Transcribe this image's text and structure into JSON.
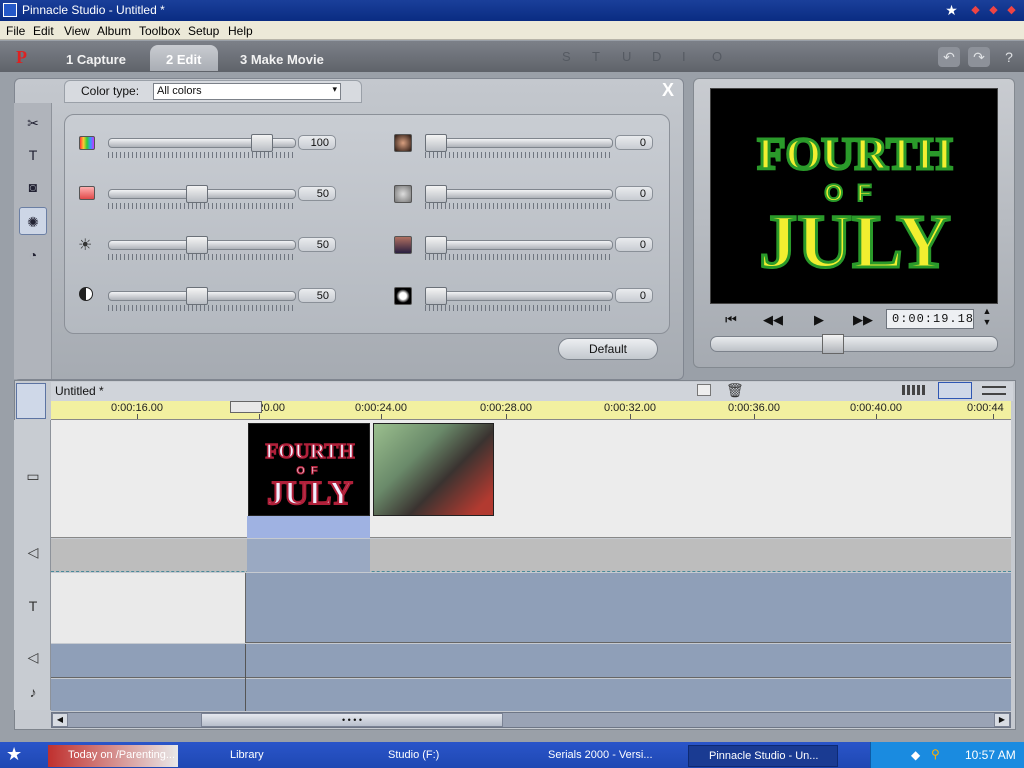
{
  "window": {
    "title": "Pinnacle Studio - Untitled *"
  },
  "menu": [
    "File",
    "Edit",
    "View",
    "Album",
    "Toolbox",
    "Setup",
    "Help"
  ],
  "mode_tabs": [
    {
      "label": "1 Capture"
    },
    {
      "label": "2 Edit"
    },
    {
      "label": "3 Make Movie"
    }
  ],
  "studio_letters": [
    "S",
    "T",
    "U",
    "D",
    "I",
    "O"
  ],
  "color_panel": {
    "color_type_label": "Color type:",
    "color_type_value": "All colors",
    "left_sliders": [
      {
        "icon": "hue-icon",
        "value": 100,
        "label": "100",
        "level": 0.86
      },
      {
        "icon": "saturation-icon",
        "value": 50,
        "label": "50",
        "level": 0.47
      },
      {
        "icon": "brightness-icon",
        "value": 50,
        "label": "50",
        "level": 0.47
      },
      {
        "icon": "contrast-icon",
        "value": 50,
        "label": "50",
        "level": 0.47
      }
    ],
    "right_sliders": [
      {
        "icon": "blur-icon",
        "value": 0,
        "label": "0",
        "level": 0
      },
      {
        "icon": "emboss-icon",
        "value": 0,
        "label": "0",
        "level": 0
      },
      {
        "icon": "mosaic-icon",
        "value": 0,
        "label": "0",
        "level": 0
      },
      {
        "icon": "posterize-icon",
        "value": 0,
        "label": "0",
        "level": 0
      }
    ],
    "default_label": "Default",
    "close_label": "X"
  },
  "preview": {
    "title_line1": "FOURTH",
    "title_line2": "OF",
    "title_line3": "JULY",
    "timecode": "0:00:19.18",
    "scrub_position": 0.42
  },
  "timeline": {
    "title": "Untitled *",
    "ruler": [
      "0:00:16.00",
      "0:00:20.00",
      "0:00:24.00",
      "0:00:28.00",
      "0:00:32.00",
      "0:00:36.00",
      "0:00:40.00",
      "0:00:44"
    ],
    "clip1": {
      "line1": "FOURTH",
      "line2": "OF",
      "line3": "JULY"
    },
    "scroll_grip": "• • • •"
  },
  "taskbar": {
    "items": [
      "Today on /Parenting...",
      "Library",
      "Studio (F:)",
      "Serials 2000 - Versi...",
      "Pinnacle Studio - Un..."
    ],
    "clock": "10:57 AM"
  },
  "colors": {
    "accent": "#0a2c82",
    "ruler": "#f2f0a0",
    "track_blue": "#8f9fb8"
  }
}
